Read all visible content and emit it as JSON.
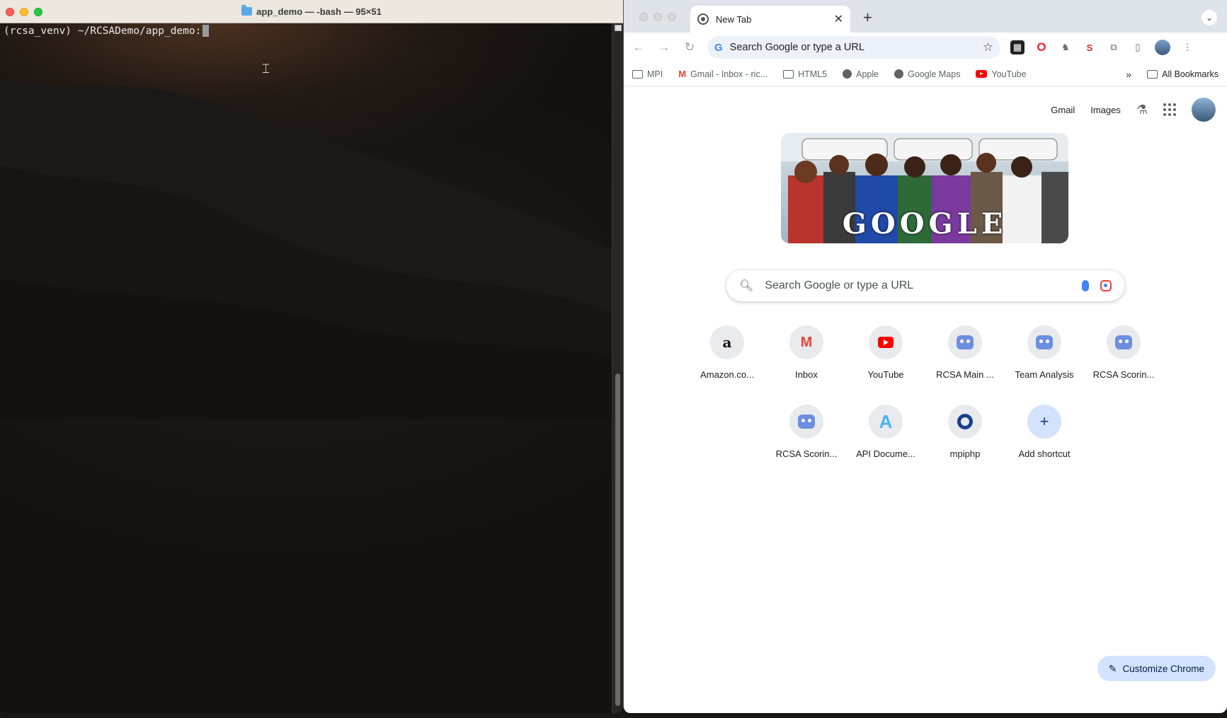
{
  "terminal": {
    "title": "app_demo — -bash — 95×51",
    "prompt": "(rcsa_venv) ~/RCSADemo/app_demo:"
  },
  "browser": {
    "tab_title": "New Tab",
    "omnibox_placeholder": "Search Google or type a URL",
    "bookmarks": [
      {
        "label": "MPI",
        "icon": "folder-icon"
      },
      {
        "label": "Gmail - Inbox - ric...",
        "icon": "gmail-icon"
      },
      {
        "label": "HTML5",
        "icon": "folder-icon"
      },
      {
        "label": "Apple",
        "icon": "globe-icon"
      },
      {
        "label": "Google Maps",
        "icon": "globe-icon"
      },
      {
        "label": "YouTube",
        "icon": "youtube-icon"
      }
    ],
    "all_bookmarks": "All Bookmarks",
    "more_bookmarks": "»"
  },
  "ntp": {
    "gmail_link": "Gmail",
    "images_link": "Images",
    "doodle_text": "GOOGLE",
    "search_placeholder": "Search Google or type a URL",
    "shortcuts_row1": [
      {
        "label": "Amazon.co...",
        "icon": "amazon-icon"
      },
      {
        "label": "Inbox",
        "icon": "gmail-icon"
      },
      {
        "label": "YouTube",
        "icon": "youtube-icon"
      },
      {
        "label": "RCSA Main ...",
        "icon": "bot-icon"
      },
      {
        "label": "Team Analysis",
        "icon": "bot-icon"
      },
      {
        "label": "RCSA Scorin...",
        "icon": "bot-icon"
      }
    ],
    "shortcuts_row2": [
      {
        "label": "RCSA Scorin...",
        "icon": "bot-icon"
      },
      {
        "label": "API Docume...",
        "icon": "api-icon"
      },
      {
        "label": "mpiphp",
        "icon": "mpi-icon"
      },
      {
        "label": "Add shortcut",
        "icon": "plus-icon"
      }
    ],
    "customize_label": "Customize Chrome"
  }
}
